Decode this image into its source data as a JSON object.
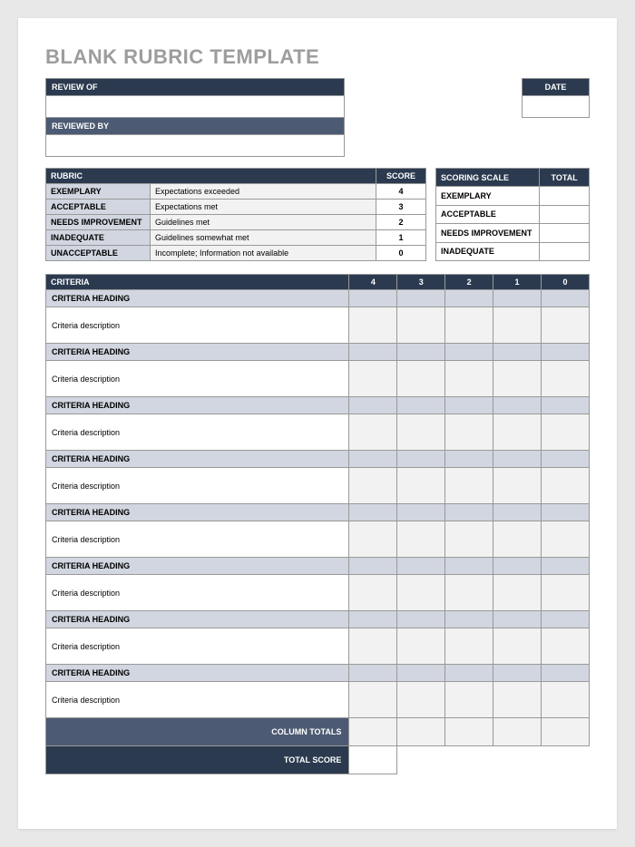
{
  "title": "BLANK RUBRIC TEMPLATE",
  "header": {
    "review_of_label": "REVIEW OF",
    "reviewed_by_label": "REVIEWED BY",
    "date_label": "DATE"
  },
  "rubric": {
    "header": "RUBRIC",
    "score_header": "SCORE",
    "rows": [
      {
        "level": "EXEMPLARY",
        "desc": "Expectations exceeded",
        "score": "4"
      },
      {
        "level": "ACCEPTABLE",
        "desc": "Expectations met",
        "score": "3"
      },
      {
        "level": "NEEDS IMPROVEMENT",
        "desc": "Guidelines met",
        "score": "2"
      },
      {
        "level": "INADEQUATE",
        "desc": "Guidelines somewhat met",
        "score": "1"
      },
      {
        "level": "UNACCEPTABLE",
        "desc": "Incomplete; Information not available",
        "score": "0"
      }
    ]
  },
  "scale": {
    "header": "SCORING SCALE",
    "total_header": "TOTAL",
    "rows": [
      {
        "level": "EXEMPLARY"
      },
      {
        "level": "ACCEPTABLE"
      },
      {
        "level": "NEEDS IMPROVEMENT"
      },
      {
        "level": "INADEQUATE"
      }
    ]
  },
  "criteria": {
    "header": "CRITERIA",
    "cols": [
      "4",
      "3",
      "2",
      "1",
      "0"
    ],
    "rows": [
      {
        "heading": "CRITERIA HEADING",
        "desc": "Criteria description"
      },
      {
        "heading": "CRITERIA HEADING",
        "desc": "Criteria description"
      },
      {
        "heading": "CRITERIA HEADING",
        "desc": "Criteria description"
      },
      {
        "heading": "CRITERIA HEADING",
        "desc": "Criteria description"
      },
      {
        "heading": "CRITERIA HEADING",
        "desc": "Criteria description"
      },
      {
        "heading": "CRITERIA HEADING",
        "desc": "Criteria description"
      },
      {
        "heading": "CRITERIA HEADING",
        "desc": "Criteria description"
      },
      {
        "heading": "CRITERIA HEADING",
        "desc": "Criteria description"
      }
    ],
    "column_totals_label": "COLUMN TOTALS",
    "total_score_label": "TOTAL SCORE"
  }
}
